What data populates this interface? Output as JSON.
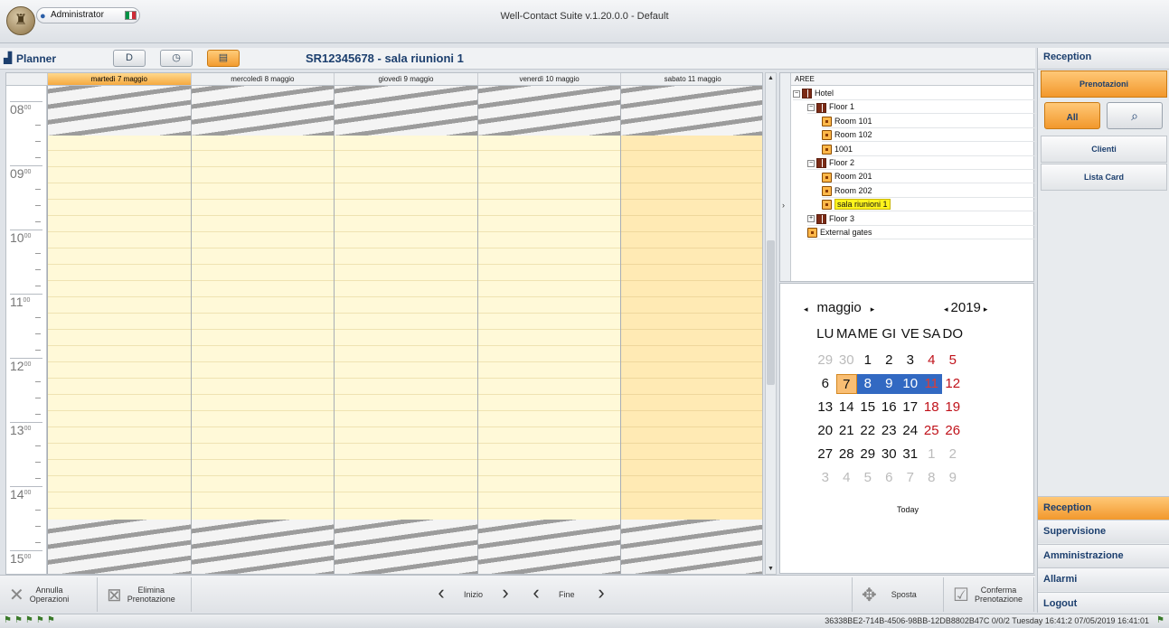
{
  "window": {
    "title": "Well-Contact Suite v.1.20.0.0 - Default"
  },
  "user": {
    "name": "Administrator",
    "flag_colors": [
      "#009246",
      "#ffffff",
      "#ce2b37"
    ]
  },
  "planner": {
    "label": "Planner",
    "room_title": "SR12345678 - sala riunioni 1",
    "view_buttons": [
      {
        "name": "day-view",
        "glyph": "D"
      },
      {
        "name": "time-view",
        "glyph": "◷"
      },
      {
        "name": "week-view",
        "glyph": "▤",
        "active": true
      }
    ],
    "days": [
      {
        "label": "martedì 7 maggio",
        "active": true
      },
      {
        "label": "mercoledì 8 maggio"
      },
      {
        "label": "giovedì 9 maggio"
      },
      {
        "label": "venerdì 10 maggio"
      },
      {
        "label": "sabato 11 maggio"
      }
    ],
    "hours": [
      "08",
      "09",
      "10",
      "11",
      "12",
      "13",
      "14",
      "15"
    ],
    "hour_minutes": "00"
  },
  "tree": {
    "header": "AREE",
    "nodes": [
      {
        "label": "Hotel",
        "type": "area",
        "level": 0,
        "exp": "−"
      },
      {
        "label": "Floor 1",
        "type": "area",
        "level": 1,
        "exp": "−"
      },
      {
        "label": "Room 101",
        "type": "room",
        "level": 2
      },
      {
        "label": "Room 102",
        "type": "room",
        "level": 2
      },
      {
        "label": "1001",
        "type": "room",
        "level": 2
      },
      {
        "label": "Floor 2",
        "type": "area",
        "level": 1,
        "exp": "−"
      },
      {
        "label": "Room 201",
        "type": "room",
        "level": 2
      },
      {
        "label": "Room 202",
        "type": "room",
        "level": 2
      },
      {
        "label": "sala riunioni 1",
        "type": "room",
        "level": 2,
        "selected": true
      },
      {
        "label": "Floor 3",
        "type": "area",
        "level": 1,
        "exp": "+"
      },
      {
        "label": "External gates",
        "type": "room",
        "level": 1
      }
    ]
  },
  "calendar": {
    "month": "maggio",
    "year": "2019",
    "weekdays": [
      "LU",
      "MA",
      "ME",
      "GI",
      "VE",
      "SA",
      "DO"
    ],
    "weeks": [
      [
        {
          "d": "29",
          "dim": true
        },
        {
          "d": "30",
          "dim": true
        },
        {
          "d": "1"
        },
        {
          "d": "2"
        },
        {
          "d": "3"
        },
        {
          "d": "4",
          "we": true
        },
        {
          "d": "5",
          "we": true
        }
      ],
      [
        {
          "d": "6"
        },
        {
          "d": "7",
          "today": true
        },
        {
          "d": "8",
          "sel": true
        },
        {
          "d": "9",
          "sel": true
        },
        {
          "d": "10",
          "sel": true
        },
        {
          "d": "11",
          "sel": true,
          "we": true
        },
        {
          "d": "12",
          "we": true
        }
      ],
      [
        {
          "d": "13"
        },
        {
          "d": "14"
        },
        {
          "d": "15"
        },
        {
          "d": "16"
        },
        {
          "d": "17"
        },
        {
          "d": "18",
          "we": true
        },
        {
          "d": "19",
          "we": true
        }
      ],
      [
        {
          "d": "20"
        },
        {
          "d": "21"
        },
        {
          "d": "22"
        },
        {
          "d": "23"
        },
        {
          "d": "24"
        },
        {
          "d": "25",
          "we": true
        },
        {
          "d": "26",
          "we": true
        }
      ],
      [
        {
          "d": "27"
        },
        {
          "d": "28"
        },
        {
          "d": "29"
        },
        {
          "d": "30"
        },
        {
          "d": "31"
        },
        {
          "d": "1",
          "dim": true
        },
        {
          "d": "2",
          "dim": true
        }
      ],
      [
        {
          "d": "3",
          "dim": true
        },
        {
          "d": "4",
          "dim": true
        },
        {
          "d": "5",
          "dim": true
        },
        {
          "d": "6",
          "dim": true
        },
        {
          "d": "7",
          "dim": true
        },
        {
          "d": "8",
          "dim": true
        },
        {
          "d": "9",
          "dim": true
        }
      ]
    ],
    "today_label": "Today"
  },
  "toolbar": {
    "annulla": [
      "Annulla",
      "Operazioni"
    ],
    "elimina": [
      "Elimina",
      "Prenotazione"
    ],
    "inizio": "Inizio",
    "fine": "Fine",
    "sposta": "Sposta",
    "conferma": [
      "Conferma",
      "Prenotazione"
    ]
  },
  "right_panel": {
    "title": "Reception",
    "prenotazioni": "Prenotazioni",
    "clienti": "Clienti",
    "lista_card": "Lista Card",
    "all_glyph": "All",
    "menu": [
      {
        "label": "Reception",
        "active": true
      },
      {
        "label": "Supervisione"
      },
      {
        "label": "Amministrazione"
      },
      {
        "label": "Allarmi"
      },
      {
        "label": "Logout"
      }
    ]
  },
  "status": {
    "text": "36338BE2-714B-4506-98BB-12DB8802B47C 0/0/2 Tuesday 16:41:2 07/05/2019 16:41:01"
  },
  "colors": {
    "accent_orange": "#f39c30",
    "selection_blue": "#3269c2",
    "weekend_red": "#c0121a",
    "header_blue": "#1c3f6e"
  }
}
